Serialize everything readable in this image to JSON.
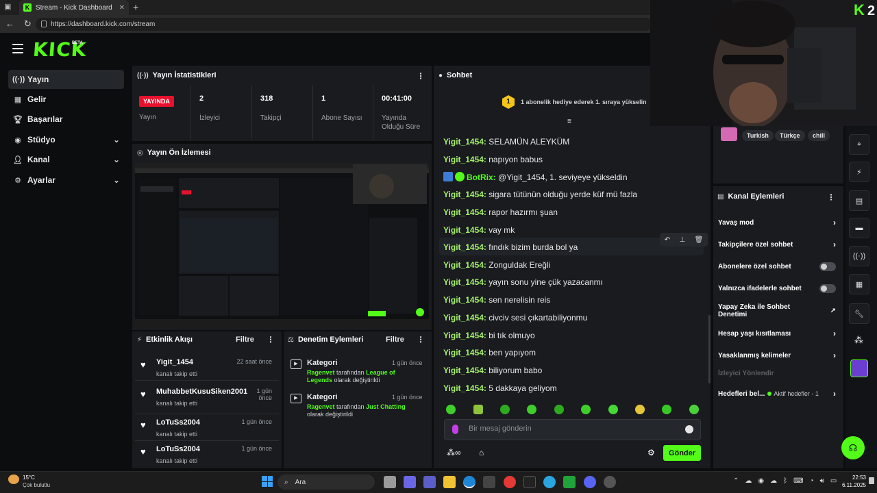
{
  "browser": {
    "tab_title": "Stream - Kick Dashboard",
    "url": "https://dashboard.kick.com/stream"
  },
  "header": {
    "logo": "KICK",
    "beta": "BETA"
  },
  "sidebar": {
    "items": [
      {
        "label": "Yayın",
        "icon": "broadcast-icon"
      },
      {
        "label": "Gelir",
        "icon": "revenue-icon"
      },
      {
        "label": "Başarılar",
        "icon": "trophy-icon"
      },
      {
        "label": "Stüdyo",
        "icon": "studio-icon"
      },
      {
        "label": "Kanal",
        "icon": "user-icon"
      },
      {
        "label": "Ayarlar",
        "icon": "gear-icon"
      }
    ]
  },
  "stats": {
    "title": "Yayın İstatistikleri",
    "live_badge": "YAYINDA",
    "live_label": "Yayın",
    "viewers_value": "2",
    "viewers_label": "İzleyici",
    "followers_value": "318",
    "followers_label": "Takipçi",
    "subs_value": "1",
    "subs_label": "Abone Sayısı",
    "uptime_value": "00:41:00",
    "uptime_label": "Yayında Olduğu Süre"
  },
  "preview": {
    "title": "Yayın Ön İzlemesi"
  },
  "activity": {
    "title": "Etkinlik Akışı",
    "filter": "Filtre",
    "events": [
      {
        "name": "Yigit_1454",
        "time": "22 saat önce",
        "desc": "kanalı takip etti"
      },
      {
        "name": "MuhabbetKusuSiken2001",
        "time": "1 gün önce",
        "desc": "kanalı takip etti"
      },
      {
        "name": "LoTuSs2004",
        "time": "1 gün önce",
        "desc": "kanalı takip etti"
      },
      {
        "name": "LoTuSs2004",
        "time": "1 gün önce",
        "desc": "kanalı takip etti"
      }
    ]
  },
  "moderation": {
    "title": "Denetim Eylemleri",
    "filter": "Filtre",
    "items": [
      {
        "kind": "Kategori",
        "time": "1 gün önce",
        "user": "Ragenvet",
        "mid": " tarafından ",
        "target": "League of Legends",
        "end": " olarak değiştirildi"
      },
      {
        "kind": "Kategori",
        "time": "1 gün önce",
        "user": "Ragenvet",
        "mid": " tarafından ",
        "target": "Just Chatting",
        "end": " olarak değiştirildi"
      }
    ]
  },
  "chat": {
    "title": "Sohbet",
    "gift_text": "1 abonelik hediye ederek 1. sıraya yükselin",
    "messages": [
      {
        "user": "Yigit_1454:",
        "text": " SELAMÜN ALEYKÜM"
      },
      {
        "user": "Yigit_1454:",
        "text": " napıyon babus"
      },
      {
        "user": "BotRix:",
        "text": " @Yigit_1454, 1. seviyeye yükseldin"
      },
      {
        "user": "Yigit_1454:",
        "text": " sigara tütünün olduğu yerde küf mü fazla"
      },
      {
        "user": "Yigit_1454:",
        "text": " rapor hazırmı şuan"
      },
      {
        "user": "Yigit_1454:",
        "text": " vay mk"
      },
      {
        "user": "Yigit_1454:",
        "text": " fındık bizim burda bol ya"
      },
      {
        "user": "Yigit_1454:",
        "text": " Zonguldak Ereğli"
      },
      {
        "user": "Yigit_1454:",
        "text": " yayın sonu yine çük yazacanmı"
      },
      {
        "user": "Yigit_1454:",
        "text": " sen nerelisin reis"
      },
      {
        "user": "Yigit_1454:",
        "text": " civciv sesi çıkartabiliyonmu"
      },
      {
        "user": "Yigit_1454:",
        "text": " bi tık olmuyo"
      },
      {
        "user": "Yigit_1454:",
        "text": " ben yapıyom"
      },
      {
        "user": "Yigit_1454:",
        "text": " biliyorum babo"
      },
      {
        "user": "Yigit_1454:",
        "text": " 5 dakkaya geliyom"
      }
    ],
    "input_placeholder": "Bir mesaj gönderin",
    "send": "Gönder"
  },
  "channel": {
    "tags": [
      "Turkish",
      "Türkçe",
      "chill"
    ],
    "actions_title": "Kanal Eylemleri",
    "actions": [
      {
        "label": "Yavaş mod",
        "control": "chevron"
      },
      {
        "label": "Takipçilere özel sohbet",
        "control": "chevron"
      },
      {
        "label": "Abonelere özel sohbet",
        "control": "toggle"
      },
      {
        "label": "Yalnızca ifadelerle sohbet",
        "control": "toggle"
      },
      {
        "label": "Yapay Zeka ile Sohbet Denetimi",
        "control": "external"
      },
      {
        "label": "Hesap yaşı kısıtlaması",
        "control": "chevron"
      },
      {
        "label": "Yasaklanmış kelimeler",
        "control": "chevron"
      },
      {
        "label": "İzleyici Yönlendir",
        "control": "none"
      },
      {
        "label": "Hedefleri bel...",
        "control": "chevron"
      }
    ],
    "goals_status": "Aktif hedefler - 1"
  },
  "taskbar": {
    "weather_temp": "15°C",
    "weather_desc": "Çok bulutlu",
    "search": "Ara",
    "time": "22:53",
    "date": "6.11.2025"
  },
  "colors": {
    "accent": "#53fc18",
    "live": "#e8112d",
    "panel": "#191b1f"
  }
}
